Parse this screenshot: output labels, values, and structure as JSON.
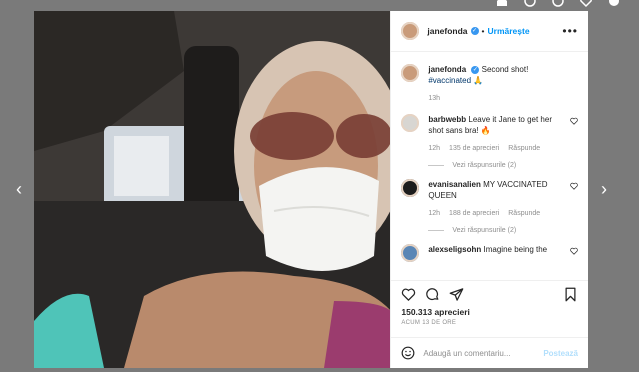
{
  "header": {
    "username": "janefonda",
    "follow_label": "Urmărește",
    "more_icon": "more-dots-icon"
  },
  "caption": {
    "username": "janefonda",
    "text": "Second shot!",
    "hashtag": "#vaccinated",
    "emoji": "🙏",
    "time": "13h"
  },
  "comments": [
    {
      "username": "barbwebb",
      "text": "Leave it Jane to get her shot sans bra!",
      "emoji": "🔥",
      "time": "12h",
      "likes": "135 de aprecieri",
      "reply_label": "Răspunde",
      "view_replies": "Vezi răspunsurile (2)"
    },
    {
      "username": "evanisanalien",
      "text": "MY VACCINATED QUEEN",
      "time": "12h",
      "likes": "188 de aprecieri",
      "reply_label": "Răspunde",
      "view_replies": "Vezi răspunsurile (2)"
    },
    {
      "username": "alexseligsohn",
      "text": "Imagine being the"
    }
  ],
  "footer": {
    "likes_count": "150.313 aprecieri",
    "posted_ago": "ACUM 13 DE ORE",
    "comment_placeholder": "Adaugă un comentariu...",
    "post_label": "Postează"
  },
  "colors": {
    "accent": "#0095f6",
    "verified": "#3897f0",
    "muted": "#8e8e8e",
    "post_disabled": "#b2dffc"
  }
}
